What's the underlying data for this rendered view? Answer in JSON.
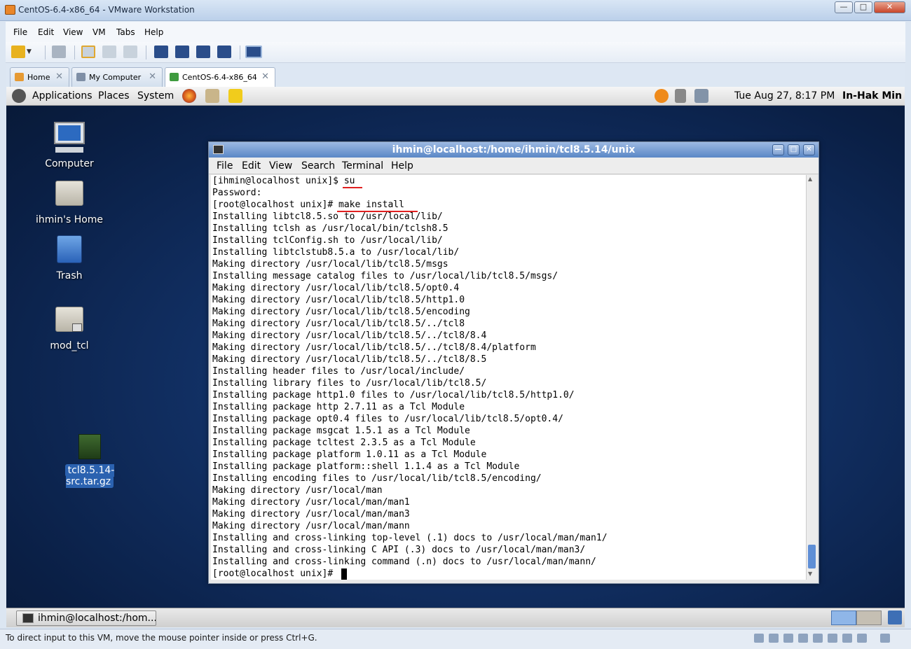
{
  "window": {
    "title": "CentOS-6.4-x86_64 - VMware Workstation",
    "buttons": [
      "—",
      "□",
      "✕"
    ]
  },
  "menu": [
    "File",
    "Edit",
    "View",
    "VM",
    "Tabs",
    "Help"
  ],
  "tabs": [
    {
      "label": "Home",
      "icon": "home-icon"
    },
    {
      "label": "My Computer",
      "icon": "computer-icon"
    },
    {
      "label": "CentOS-6.4-x86_64",
      "icon": "vm-icon",
      "active": true
    }
  ],
  "guest_panel": {
    "menus": [
      "Applications",
      "Places",
      "System"
    ],
    "clock": "Tue Aug 27,  8:17 PM",
    "user": "In-Hak Min"
  },
  "desktop_icons": [
    {
      "label": "Computer"
    },
    {
      "label": "ihmin's Home"
    },
    {
      "label": "Trash"
    },
    {
      "label": "mod_tcl"
    },
    {
      "label": "tcl8.5.14-src.tar.gz"
    }
  ],
  "terminal": {
    "title": "ihmin@localhost:/home/ihmin/tcl8.5.14/unix",
    "menu": [
      "File",
      "Edit",
      "View",
      "Search",
      "Terminal",
      "Help"
    ],
    "lines": [
      "[ihmin@localhost unix]$ su",
      "Password:",
      "[root@localhost unix]# make install",
      "Installing libtcl8.5.so to /usr/local/lib/",
      "Installing tclsh as /usr/local/bin/tclsh8.5",
      "Installing tclConfig.sh to /usr/local/lib/",
      "Installing libtclstub8.5.a to /usr/local/lib/",
      "Making directory /usr/local/lib/tcl8.5/msgs",
      "Installing message catalog files to /usr/local/lib/tcl8.5/msgs/",
      "Making directory /usr/local/lib/tcl8.5/opt0.4",
      "Making directory /usr/local/lib/tcl8.5/http1.0",
      "Making directory /usr/local/lib/tcl8.5/encoding",
      "Making directory /usr/local/lib/tcl8.5/../tcl8",
      "Making directory /usr/local/lib/tcl8.5/../tcl8/8.4",
      "Making directory /usr/local/lib/tcl8.5/../tcl8/8.4/platform",
      "Making directory /usr/local/lib/tcl8.5/../tcl8/8.5",
      "Installing header files to /usr/local/include/",
      "Installing library files to /usr/local/lib/tcl8.5/",
      "Installing package http1.0 files to /usr/local/lib/tcl8.5/http1.0/",
      "Installing package http 2.7.11 as a Tcl Module",
      "Installing package opt0.4 files to /usr/local/lib/tcl8.5/opt0.4/",
      "Installing package msgcat 1.5.1 as a Tcl Module",
      "Installing package tcltest 2.3.5 as a Tcl Module",
      "Installing package platform 1.0.11 as a Tcl Module",
      "Installing package platform::shell 1.1.4 as a Tcl Module",
      "Installing encoding files to /usr/local/lib/tcl8.5/encoding/",
      "Making directory /usr/local/man",
      "Making directory /usr/local/man/man1",
      "Making directory /usr/local/man/man3",
      "Making directory /usr/local/man/mann",
      "Installing and cross-linking top-level (.1) docs to /usr/local/man/man1/",
      "Installing and cross-linking C API (.3) docs to /usr/local/man/man3/",
      "Installing and cross-linking command (.n) docs to /usr/local/man/mann/",
      "[root@localhost unix]# "
    ]
  },
  "taskbar": {
    "label": "ihmin@localhost:/hom..."
  },
  "status": {
    "text": "To direct input to this VM, move the mouse pointer inside or press Ctrl+G."
  },
  "colors": {
    "desktop": "#123166",
    "terminal_title": "#5a87c6",
    "annotation": "#e02020",
    "selection": "#2b62b0"
  }
}
